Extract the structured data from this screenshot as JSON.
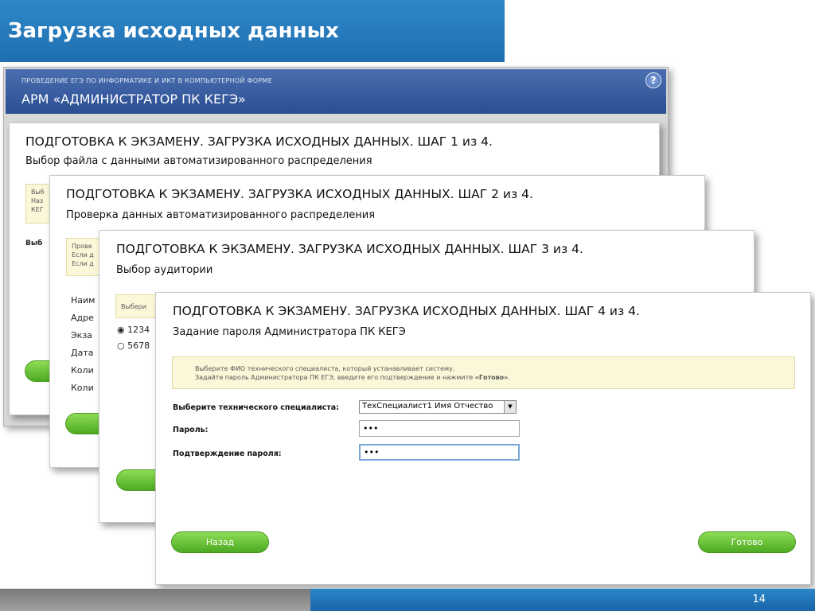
{
  "slide": {
    "title": "Загрузка исходных данных",
    "page_number": "14"
  },
  "app": {
    "subtitle": "ПРОВЕДЕНИЕ ЕГЭ ПО ИНФОРМАТИКЕ И ИКТ В КОМПЬЮТЕРНОЙ ФОРМЕ",
    "title": "АРМ «АДМИНИСТРАТОР ПК КЕГЭ»",
    "help_label": "?"
  },
  "steps": [
    {
      "title": "ПОДГОТОВКА К ЭКЗАМЕНУ. ЗАГРУЗКА ИСХОДНЫХ ДАННЫХ. ШАГ 1 из 4.",
      "subtitle": "Выбор файла с данными автоматизированного распределения",
      "info_lines": [
        "Выб",
        "Наз",
        "КЕГ"
      ],
      "fragment": "Выб"
    },
    {
      "title": "ПОДГОТОВКА К ЭКЗАМЕНУ. ЗАГРУЗКА ИСХОДНЫХ ДАННЫХ. ШАГ 2 из 4.",
      "subtitle": "Проверка данных автоматизированного распределения",
      "info_lines": [
        "Прове",
        "Если д",
        "Если д"
      ],
      "fields": [
        "Наим",
        "Адре",
        "Экза",
        "Дата",
        "Коли",
        "Коли"
      ]
    },
    {
      "title": "ПОДГОТОВКА К ЭКЗАМЕНУ. ЗАГРУЗКА ИСХОДНЫХ ДАННЫХ. ШАГ 3 из 4.",
      "subtitle": "Выбор аудитории",
      "info_lines": [
        "Выбери"
      ],
      "options": [
        "1234",
        "5678"
      ]
    },
    {
      "title": "ПОДГОТОВКА К ЭКЗАМЕНУ. ЗАГРУЗКА ИСХОДНЫХ ДАННЫХ. ШАГ 4 из 4.",
      "subtitle": "Задание пароля Администратора ПК КЕГЭ",
      "info_line1": "Выберите ФИО технического специалиста, который устанавливает систему.",
      "info_line2": "Задайте пароль Администратора ПК ЕГЭ, введите его подтверждение и нажмите ",
      "info_line2_bold": "«Готово»",
      "info_line2_end": ".",
      "specialist_label": "Выберите технического специалиста:",
      "specialist_value": "ТехСпециалист1 Имя Отчество",
      "password_label": "Пароль:",
      "password_value": "•••",
      "confirm_label": "Подтверждение пароля:",
      "confirm_value": "•••",
      "back_label": "Назад",
      "done_label": "Готово"
    }
  ],
  "colors": {
    "slide_blue": "#2a86c8",
    "app_header": "#2a4e92",
    "button_green": "#5cbc2a",
    "info_bg": "#fbf8d9"
  }
}
